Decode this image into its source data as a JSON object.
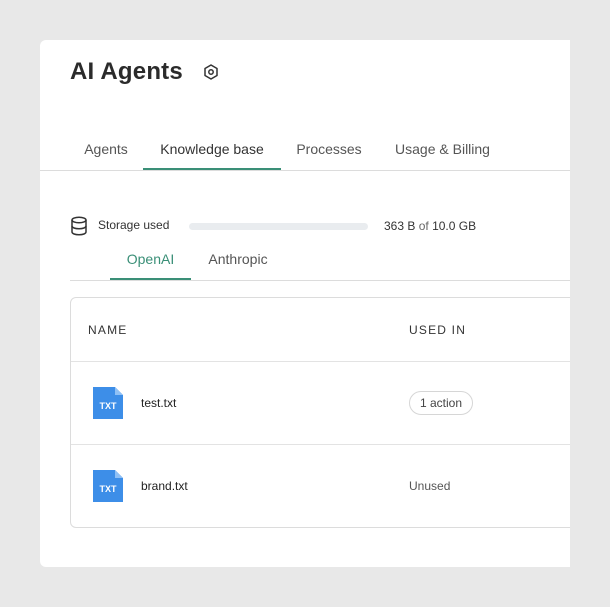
{
  "page": {
    "title": "AI Agents"
  },
  "tabs": [
    {
      "label": "Agents",
      "active": false
    },
    {
      "label": "Knowledge base",
      "active": true
    },
    {
      "label": "Processes",
      "active": false
    },
    {
      "label": "Usage & Billing",
      "active": false
    }
  ],
  "storage": {
    "label": "Storage used",
    "used": "363 B",
    "of": "of",
    "total": "10.0 GB",
    "fraction": 0.0
  },
  "subtabs": [
    {
      "label": "OpenAI",
      "active": true
    },
    {
      "label": "Anthropic",
      "active": false
    }
  ],
  "table": {
    "columns": [
      "NAME",
      "USED IN"
    ],
    "rows": [
      {
        "file_type": "TXT",
        "name": "test.txt",
        "used_in": "1 action",
        "used_is_badge": true
      },
      {
        "file_type": "TXT",
        "name": "brand.txt",
        "used_in": "Unused",
        "used_is_badge": false
      }
    ]
  },
  "colors": {
    "accent": "#3a8f77",
    "file_icon": "#3d8ee8",
    "background": "#e8e8e8"
  },
  "icons": {
    "settings": "settings-hex-icon",
    "storage": "database-icon",
    "file": "txt-file-icon"
  }
}
